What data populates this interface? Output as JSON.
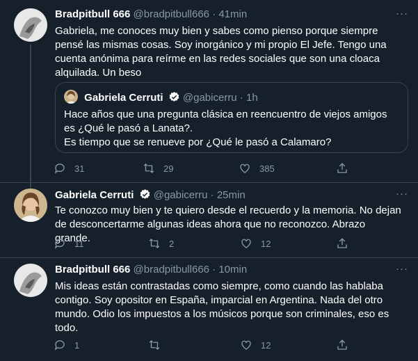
{
  "tweets": [
    {
      "name": "Bradpitbull 666",
      "handle": "@bradpitbull666",
      "time": "41min",
      "text": "Gabriela, me conoces muy bien y sabes como pienso porque siempre pensé las mismas cosas. Soy inorgánico y mi propio El Jefe. Tengo una cuenta anónima para reírme en las redes sociales que son una cloaca alquilada. Un beso",
      "quote": {
        "name": "Gabriela Cerruti",
        "handle": "@gabicerru",
        "time": "1h",
        "line1": "Hace años que una pregunta clásica en reencuentro de viejos amigos es ¿Qué le pasó a Lanata?.",
        "line2": "Es tiempo que se renueve por ¿Qué le pasó a Calamaro?"
      },
      "replies": "31",
      "retweets": "29",
      "likes": "385"
    },
    {
      "name": "Gabriela Cerruti",
      "handle": "@gabicerru",
      "time": "25min",
      "text": "Te conozco muy bien y te quiero desde el recuerdo y la memoria. No dejan de desconcertarme algunas ideas ahora que no reconozco. Abrazo grande.",
      "replies": "11",
      "retweets": "2",
      "likes": "12"
    },
    {
      "name": "Bradpitbull 666",
      "handle": "@bradpitbull666",
      "time": "10min",
      "text": "Mis ideas están contrastadas como siempre, como cuando las hablaba contigo. Soy opositor en España, imparcial en Argentina. Nada del otro mundo. Odio los impuestos a los músicos porque son criminales, eso es todo.",
      "replies": "1",
      "retweets": "",
      "likes": "12"
    }
  ],
  "separator": "·",
  "more_glyph": "···",
  "colors": {
    "background": "#15202b",
    "text": "#ffffff",
    "muted": "#8899a6",
    "border": "#38444d",
    "verified": "#ffffff"
  }
}
